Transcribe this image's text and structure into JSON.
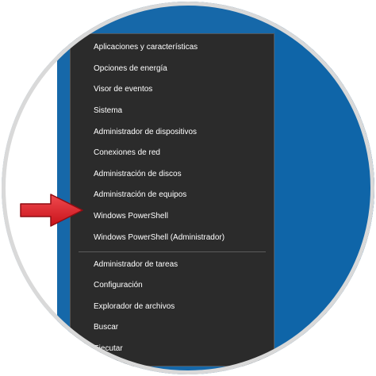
{
  "menu": {
    "items": [
      {
        "label": "Aplicaciones y características"
      },
      {
        "label": "Opciones de energía"
      },
      {
        "label": "Visor de eventos"
      },
      {
        "label": "Sistema"
      },
      {
        "label": "Administrador de dispositivos"
      },
      {
        "label": "Conexiones de red"
      },
      {
        "label": "Administración de discos"
      },
      {
        "label": "Administración de equipos"
      },
      {
        "label": "Windows PowerShell"
      },
      {
        "label": "Windows PowerShell (Administrador)"
      },
      {
        "label": "Administrador de tareas"
      },
      {
        "label": "Configuración"
      },
      {
        "label": "Explorador de archivos"
      },
      {
        "label": "Buscar"
      },
      {
        "label": "Ejecutar"
      }
    ]
  },
  "pointer_arrow": {
    "icon": "red-arrow-icon",
    "color": "#e2232a"
  },
  "colors": {
    "desktop_blue": "#1668a9",
    "menu_bg": "#2b2b2b",
    "menu_text": "#ffffff"
  }
}
